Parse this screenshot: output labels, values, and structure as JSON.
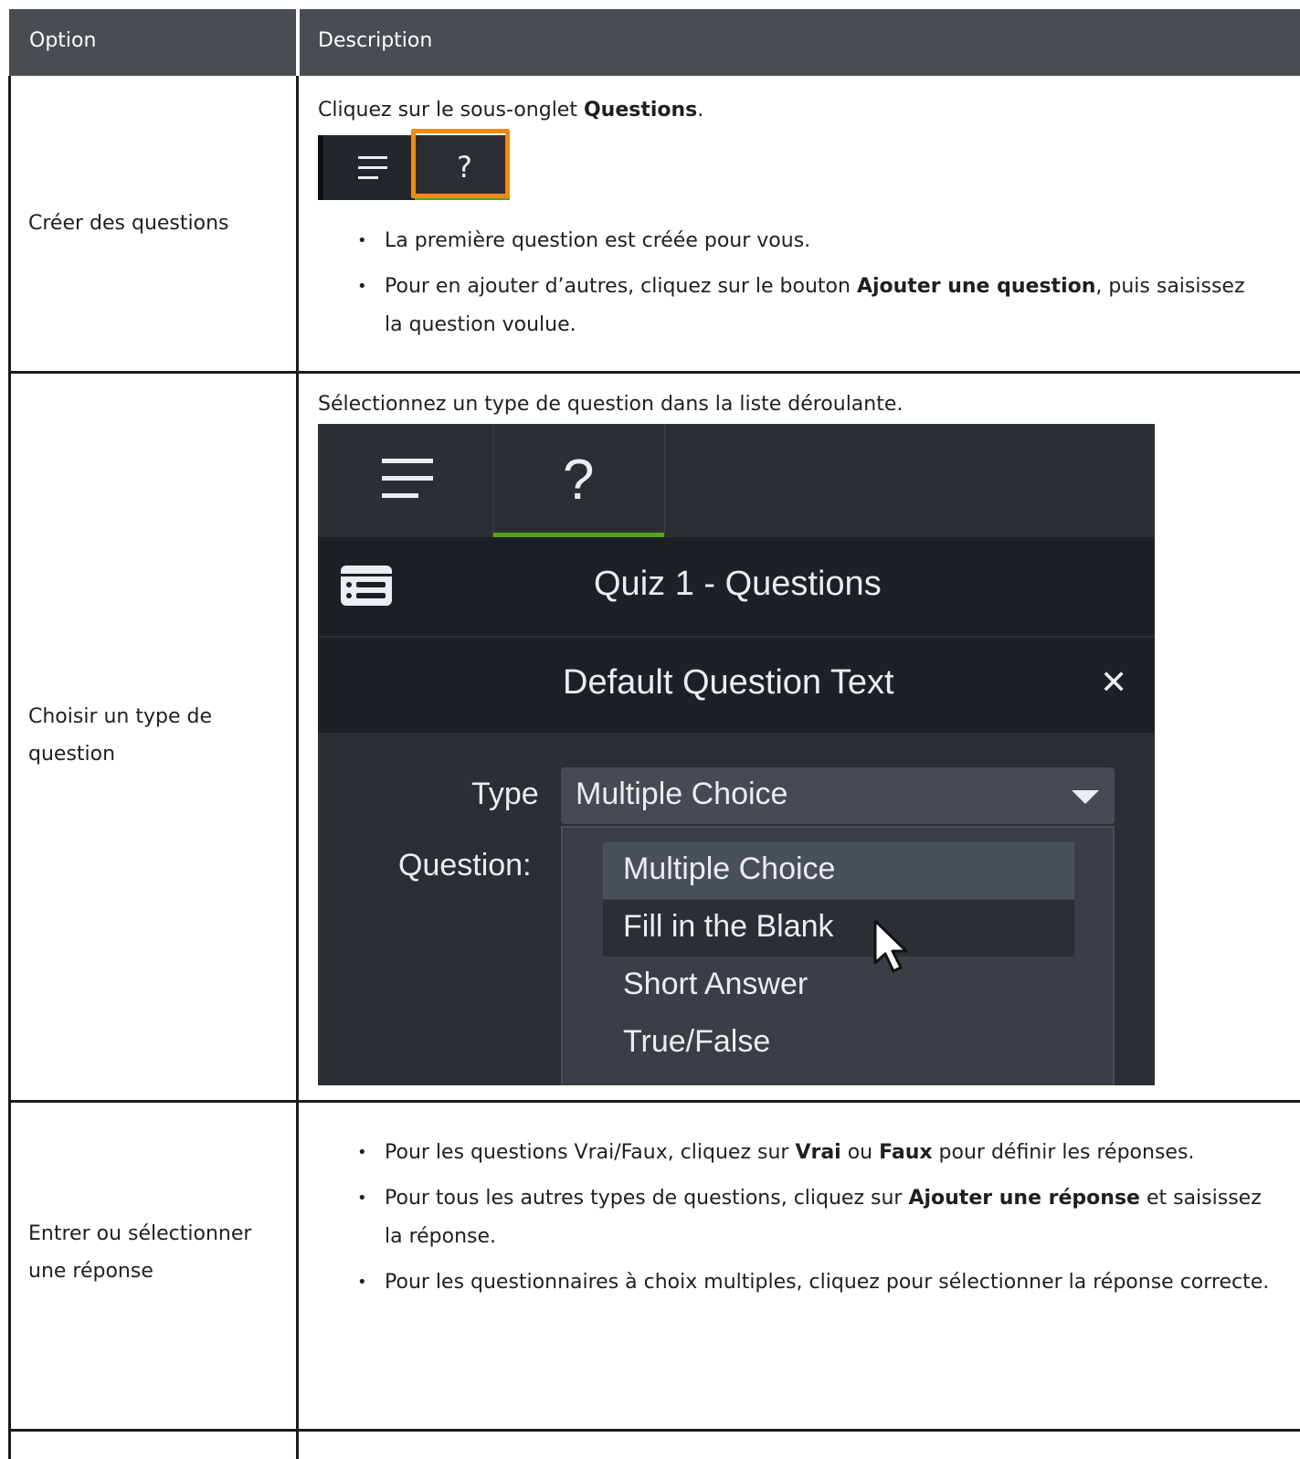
{
  "table": {
    "headers": [
      "Option",
      "Description"
    ],
    "rows": [
      {
        "option": "Créer des questions",
        "intro_pre": "Cliquez sur le sous-onglet ",
        "intro_bold": "Questions",
        "intro_post": ".",
        "bullets": [
          {
            "pre": "La première question est créée pour vous.",
            "bold": "",
            "post": ""
          },
          {
            "pre": "Pour en ajouter d’autres, cliquez sur le bouton ",
            "bold": "Ajouter une question",
            "post": ", puis saisissez la question voulue."
          }
        ]
      },
      {
        "option_line1": "Choisir un type de",
        "option_line2": "question",
        "intro": "Sélectionnez un type de question dans la liste déroulante."
      },
      {
        "option_line1": "Entrer ou sélectionner",
        "option_line2": "une réponse",
        "b1_pre": "Pour les questions Vrai/Faux, cliquez sur ",
        "b1_bold1": "Vrai",
        "b1_mid": " ou ",
        "b1_bold2": "Faux",
        "b1_post": " pour définir les réponses.",
        "b2_pre": "Pour tous les autres types de questions, cliquez sur ",
        "b2_bold": "Ajouter une réponse",
        "b2_post": " et saisissez la réponse.",
        "b3": "Pour les questionnaires à choix multiples, cliquez pour sélectionner la réponse correcte."
      }
    ]
  },
  "small_tabs": {
    "tab1_icon": "menu-lines-icon",
    "tab2_label": "?",
    "highlight_color": "#f08c14"
  },
  "quiz_panel": {
    "tab_question_label": "?",
    "title": "Quiz 1 - Questions",
    "question_title": "Default Question Text",
    "close_glyph": "✕",
    "type_label": "Type",
    "type_value": "Multiple Choice",
    "question_label": "Question:",
    "options": [
      "Multiple Choice",
      "Fill in the Blank",
      "Short Answer",
      "True/False"
    ],
    "active_tab_color": "#57a31a"
  }
}
